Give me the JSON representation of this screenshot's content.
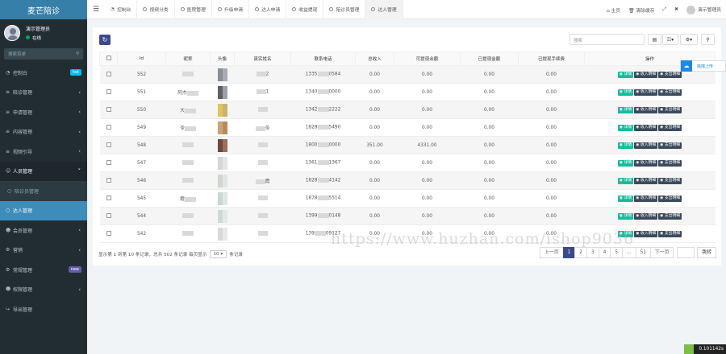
{
  "brand": "麦芒陪诊",
  "user": {
    "name": "演示管理员",
    "status": "在线"
  },
  "sidebar_search_placeholder": "搜索菜单",
  "menu": [
    {
      "label": "控制台",
      "icon": "dashboard-icon",
      "badge": "hot"
    },
    {
      "label": "陪诊管理",
      "icon": "list-icon"
    },
    {
      "label": "申请管理",
      "icon": "list-icon"
    },
    {
      "label": "内容管理",
      "icon": "list-icon"
    },
    {
      "label": "视频引导",
      "icon": "list-icon"
    },
    {
      "label": "人员管理",
      "icon": "user-icon"
    },
    {
      "label": "陪诊员管理",
      "icon": "circle-icon"
    },
    {
      "label": "达人管理",
      "icon": "circle-icon"
    },
    {
      "label": "会员管理",
      "icon": "group-icon"
    },
    {
      "label": "营销",
      "icon": "gear-icon"
    },
    {
      "label": "常规管理",
      "icon": "cogs-icon",
      "badge": "new"
    },
    {
      "label": "权限管理",
      "icon": "group-icon"
    },
    {
      "label": "导出管理",
      "icon": "share-icon"
    }
  ],
  "tabs": [
    "控制台",
    "视频分类",
    "医院管理",
    "升级申请",
    "达人申请",
    "收益提现",
    "陪诊员管理",
    "达人管理"
  ],
  "top_right": {
    "home": "主页",
    "clear": "清除缓存",
    "admin": "演示管理员"
  },
  "search_placeholder": "搜索",
  "columns": [
    "Id",
    "昵称",
    "头像",
    "真实姓名",
    "联系电话",
    "总收入",
    "可提现余额",
    "已提现金额",
    "已提现手续费",
    "操作"
  ],
  "rows": [
    {
      "id": "552",
      "nick": "",
      "real": "2",
      "phone": [
        "1335",
        "0584"
      ],
      "total": "0.00",
      "avail": "0.00",
      "withdrawn": "0.00",
      "fee": "0.00"
    },
    {
      "id": "551",
      "nick": "阿杰",
      "real": "1",
      "phone": [
        "1340",
        "0000"
      ],
      "total": "0.00",
      "avail": "0.00",
      "withdrawn": "0.00",
      "fee": "0.00"
    },
    {
      "id": "550",
      "nick": "大",
      "real": "",
      "phone": [
        "1342",
        "2222"
      ],
      "total": "0.00",
      "avail": "0.00",
      "withdrawn": "0.00",
      "fee": "0.00"
    },
    {
      "id": "549",
      "nick": "苓",
      "real": "苓",
      "phone": [
        "1828",
        "5490"
      ],
      "total": "0.00",
      "avail": "0.00",
      "withdrawn": "0.00",
      "fee": "0.00"
    },
    {
      "id": "548",
      "nick": "",
      "real": "",
      "phone": [
        "1800",
        "0000"
      ],
      "total": "351.00",
      "avail": "4331.00",
      "withdrawn": "0.00",
      "fee": "0.00"
    },
    {
      "id": "547",
      "nick": "",
      "real": "",
      "phone": [
        "1361",
        "1367"
      ],
      "total": "0.00",
      "avail": "0.00",
      "withdrawn": "0.00",
      "fee": "0.00"
    },
    {
      "id": "546",
      "nick": "",
      "real": "霞",
      "phone": [
        "1828",
        "4142"
      ],
      "total": "0.00",
      "avail": "0.00",
      "withdrawn": "0.00",
      "fee": "0.00"
    },
    {
      "id": "545",
      "nick": "霞",
      "real": "",
      "phone": [
        "1878",
        "5514"
      ],
      "total": "0.00",
      "avail": "0.00",
      "withdrawn": "0.00",
      "fee": "0.00"
    },
    {
      "id": "544",
      "nick": "",
      "real": "",
      "phone": [
        "1399",
        "0148"
      ],
      "total": "0.00",
      "avail": "0.00",
      "withdrawn": "0.00",
      "fee": "0.00"
    },
    {
      "id": "542",
      "nick": "",
      "real": "",
      "phone": [
        "139",
        "09127"
      ],
      "total": "0.00",
      "avail": "0.00",
      "withdrawn": "0.00",
      "fee": "0.00"
    }
  ],
  "actions": [
    "详情",
    "收入明细",
    "支出明细"
  ],
  "footer": {
    "text_a": "显示第 1 到第 10 条记录，总共 502 条记录 每页显示",
    "page_size": "10",
    "text_b": "条记录"
  },
  "pager": {
    "prev": "上一页",
    "pages": [
      "1",
      "2",
      "3",
      "4",
      "5",
      "...",
      "51"
    ],
    "next": "下一页",
    "jump": "跳转"
  },
  "upload": "拖拽上传",
  "watermark": "https://www.huzhan.com/ishop9036",
  "timer": "0.101142s",
  "colors": {
    "sidebar": "#222d32",
    "active": "#3c8dbc",
    "primary": "#3c4a8c",
    "success": "#18bc9c"
  }
}
